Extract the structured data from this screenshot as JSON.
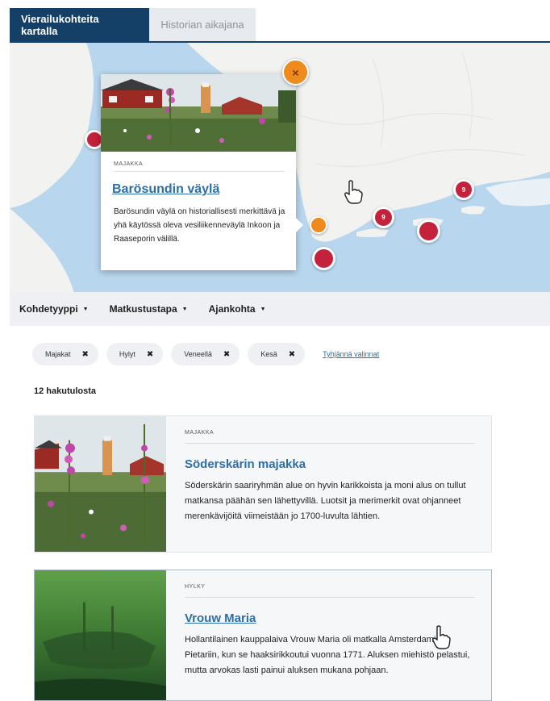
{
  "tabs": [
    {
      "label": "Vierailukohteita kartalla",
      "active": true
    },
    {
      "label": "Historian aikajana",
      "active": false
    }
  ],
  "map": {
    "popup": {
      "category": "MAJAKKA",
      "title": "Barösundin väylä",
      "description": "Barösundin väylä on historiallisesti merkittävä ja yhä käytössä oleva vesiliikenneväylä Inkoon ja Raaseporin välillä."
    },
    "close_label": "×",
    "markers": [
      {
        "kind": "red",
        "label": ""
      },
      {
        "kind": "red",
        "label": "9"
      },
      {
        "kind": "red",
        "label": "9"
      },
      {
        "kind": "red",
        "label": ""
      },
      {
        "kind": "red",
        "label": ""
      },
      {
        "kind": "orange",
        "label": ""
      }
    ]
  },
  "filters": [
    {
      "label": "Kohdetyyppi"
    },
    {
      "label": "Matkustustapa"
    },
    {
      "label": "Ajankohta"
    }
  ],
  "chips": [
    {
      "label": "Majakat"
    },
    {
      "label": "Hylyt"
    },
    {
      "label": "Veneellä"
    },
    {
      "label": "Kesä"
    }
  ],
  "clear_label": "Tyhjännä valinnat",
  "results_count": "12 hakutulosta",
  "results": [
    {
      "category": "MAJAKKA",
      "title": "Söderskärin majakka",
      "description": "Söderskärin saariryhmän alue on hyvin karikkoista ja moni alus on tullut matkansa päähän sen lähettyvillä. Luotsit ja merimerkit ovat ohjanneet merenkävijöitä viimeistään jo 1700-luvulta lähtien."
    },
    {
      "category": "HYLKY",
      "title": "Vrouw Maria",
      "description": "Hollantilainen kauppalaiva Vrouw Maria oli matkalla Amsterdamista Pietariin, kun se haaksirikkoutui vuonna 1771. Aluksen miehistö pelastui, mutta arvokas lasti painui aluksen mukana pohjaan."
    }
  ],
  "colors": {
    "primary": "#143f66",
    "link": "#2c6ea8",
    "marker_red": "#c4213c",
    "marker_orange": "#ef8a1e",
    "sea": "#b8d6ee",
    "land": "#f2f2f0"
  }
}
